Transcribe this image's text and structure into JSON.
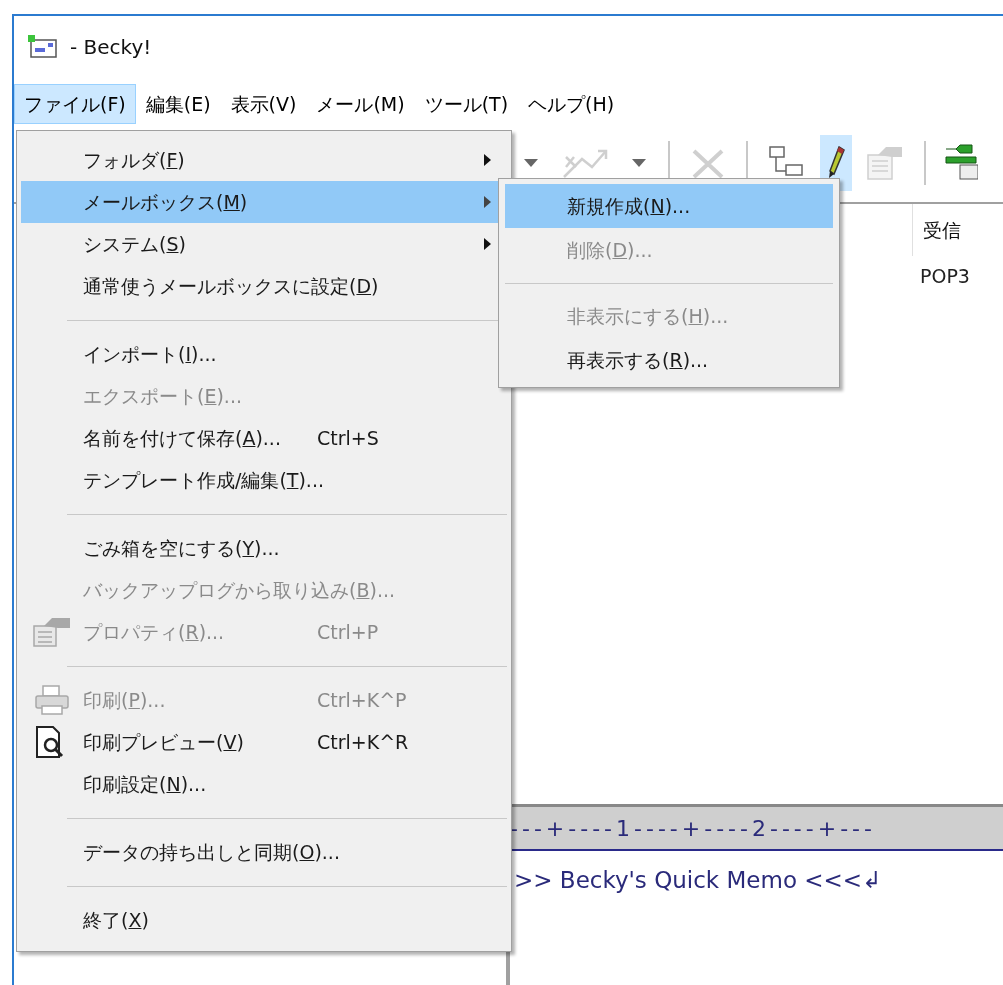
{
  "window": {
    "title": "- Becky!"
  },
  "menubar": [
    {
      "label": "ファイル(F)",
      "selected": true
    },
    {
      "label": "編集(E)",
      "selected": false
    },
    {
      "label": "表示(V)",
      "selected": false
    },
    {
      "label": "メール(M)",
      "selected": false
    },
    {
      "label": "ツール(T)",
      "selected": false
    },
    {
      "label": "ヘルプ(H)",
      "selected": false
    }
  ],
  "toolbar": [
    {
      "kind": "caret",
      "pressed": false,
      "disabled": false
    },
    {
      "kind": "forward",
      "pressed": false,
      "disabled": true
    },
    {
      "kind": "caret",
      "pressed": false,
      "disabled": false
    },
    {
      "kind": "separator"
    },
    {
      "kind": "delete",
      "pressed": false,
      "disabled": true
    },
    {
      "kind": "separator"
    },
    {
      "kind": "tree",
      "pressed": false,
      "disabled": false
    },
    {
      "kind": "compose",
      "pressed": true,
      "disabled": false
    },
    {
      "kind": "properties",
      "pressed": false,
      "disabled": true
    },
    {
      "kind": "separator"
    },
    {
      "kind": "wrench",
      "pressed": false,
      "disabled": false
    }
  ],
  "mailbox_list": {
    "columns": [
      {
        "label": "受信"
      }
    ],
    "rows": [
      [
        "POP3"
      ]
    ]
  },
  "memo": {
    "ruler": "---+----1----+----2----+---",
    "text": ">> Becky's Quick Memo <<<↲"
  },
  "file_menu": [
    {
      "kind": "item",
      "label": "フォルダ(",
      "key": "F",
      "tail": ")",
      "submenu": true,
      "disabled": false,
      "selected": false
    },
    {
      "kind": "item",
      "label": "メールボックス(",
      "key": "M",
      "tail": ")",
      "submenu": true,
      "disabled": false,
      "selected": true
    },
    {
      "kind": "item",
      "label": "システム(",
      "key": "S",
      "tail": ")",
      "submenu": true,
      "disabled": false,
      "selected": false
    },
    {
      "kind": "item",
      "label": "通常使うメールボックスに設定(",
      "key": "D",
      "tail": ")",
      "submenu": false,
      "disabled": false,
      "selected": false
    },
    {
      "kind": "separator"
    },
    {
      "kind": "item",
      "label": "インポート(",
      "key": "I",
      "tail": ")...",
      "submenu": false,
      "disabled": false,
      "selected": false
    },
    {
      "kind": "item",
      "label": "エクスポート(",
      "key": "E",
      "tail": ")...",
      "submenu": false,
      "disabled": true,
      "selected": false
    },
    {
      "kind": "item",
      "label": "名前を付けて保存(",
      "key": "A",
      "tail": ")...",
      "shortcut": "Ctrl+S",
      "submenu": false,
      "disabled": false,
      "selected": false
    },
    {
      "kind": "item",
      "label": "テンプレート作成/編集(",
      "key": "T",
      "tail": ")...",
      "submenu": false,
      "disabled": false,
      "selected": false
    },
    {
      "kind": "separator"
    },
    {
      "kind": "item",
      "label": "ごみ箱を空にする(",
      "key": "Y",
      "tail": ")...",
      "submenu": false,
      "disabled": false,
      "selected": false
    },
    {
      "kind": "item",
      "label": "バックアップログから取り込み(",
      "key": "B",
      "tail": ")...",
      "submenu": false,
      "disabled": true,
      "selected": false
    },
    {
      "kind": "properties",
      "label": "プロパティ(",
      "key": "R",
      "tail": ")...",
      "shortcut": "Ctrl+P",
      "submenu": false,
      "disabled": true,
      "selected": false
    },
    {
      "kind": "separator"
    },
    {
      "kind": "print",
      "label": "印刷(",
      "key": "P",
      "tail": ")...",
      "shortcut": "Ctrl+K^P",
      "submenu": false,
      "disabled": true,
      "selected": false
    },
    {
      "kind": "preview",
      "label": "印刷プレビュー(",
      "key": "V",
      "tail": ")",
      "shortcut": "Ctrl+K^R",
      "submenu": false,
      "disabled": false,
      "selected": false
    },
    {
      "kind": "item",
      "label": "印刷設定(",
      "key": "N",
      "tail": ")...",
      "submenu": false,
      "disabled": false,
      "selected": false
    },
    {
      "kind": "separator"
    },
    {
      "kind": "item",
      "label": "データの持ち出しと同期(",
      "key": "O",
      "tail": ")...",
      "submenu": false,
      "disabled": false,
      "selected": false
    },
    {
      "kind": "separator"
    },
    {
      "kind": "item",
      "label": "終了(",
      "key": "X",
      "tail": ")",
      "submenu": false,
      "disabled": false,
      "selected": false
    }
  ],
  "mailbox_submenu": [
    {
      "kind": "item",
      "label": "新規作成(",
      "key": "N",
      "tail": ")...",
      "disabled": false,
      "selected": true
    },
    {
      "kind": "item",
      "label": "削除(",
      "key": "D",
      "tail": ")...",
      "disabled": true,
      "selected": false
    },
    {
      "kind": "separator"
    },
    {
      "kind": "item",
      "label": "非表示にする(",
      "key": "H",
      "tail": ")...",
      "disabled": true,
      "selected": false
    },
    {
      "kind": "item",
      "label": "再表示する(",
      "key": "R",
      "tail": ")...",
      "disabled": false,
      "selected": false
    }
  ]
}
